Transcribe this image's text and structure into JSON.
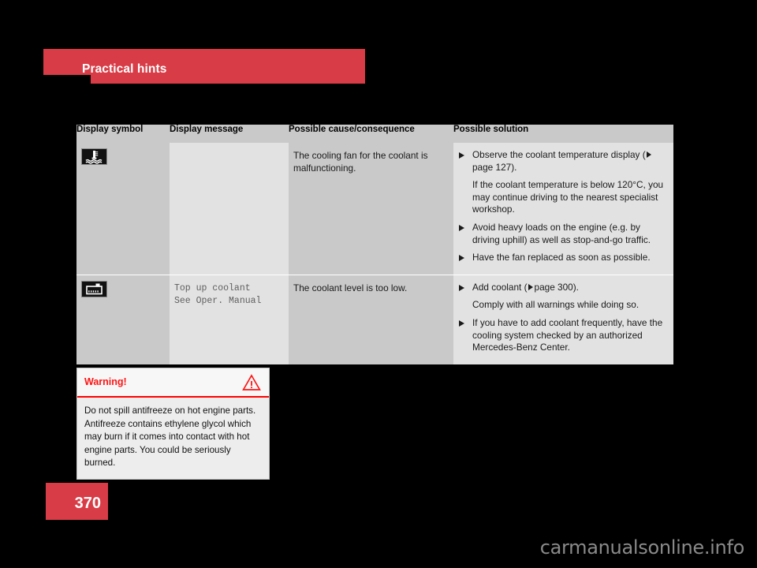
{
  "banner": {
    "title": "Practical hints",
    "accent_color": "#d83c46"
  },
  "table": {
    "headers": {
      "symbol": "Display symbol",
      "message": "Display message",
      "cause": "Possible cause/consequence",
      "solution": "Possible solution"
    },
    "rows": [
      {
        "symbol_icon": "coolant-temperature-warning-icon",
        "message": "",
        "cause": "The cooling fan for the coolant is malfunctioning.",
        "solution": [
          {
            "bullet": true,
            "text_before": "Observe the coolant temperature display (",
            "page_ref": "page 127",
            "text_after": ")."
          },
          {
            "bullet": false,
            "text": "If the coolant temperature is below 120°C, you may continue driving to the nearest specialist workshop."
          },
          {
            "bullet": true,
            "text": "Avoid heavy loads on the engine (e.g. by driving uphill) as well as stop-and-go traffic."
          },
          {
            "bullet": true,
            "text": "Have the fan replaced as soon as possible."
          }
        ]
      },
      {
        "symbol_icon": "coolant-level-warning-icon",
        "message": "Top up coolant\nSee Oper. Manual",
        "cause": "The coolant level is too low.",
        "solution": [
          {
            "bullet": true,
            "text_before": "Add coolant (",
            "page_ref": "page 300",
            "text_after": ")."
          },
          {
            "bullet": false,
            "text": "Comply with all warnings while doing so."
          },
          {
            "bullet": true,
            "text": "If you have to add coolant frequently, have the cooling system checked by an authorized Mercedes-Benz Center."
          }
        ]
      }
    ]
  },
  "warning": {
    "title": "Warning!",
    "icon": "warning-triangle-icon",
    "accent_color": "#ff1414",
    "body": "Do not spill antifreeze on hot engine parts. Antifreeze contains ethylene glycol which may burn if it comes into contact with hot engine parts. You could be seriously burned."
  },
  "footer": {
    "page_number": "370",
    "watermark": "carmanualsonline.info"
  }
}
